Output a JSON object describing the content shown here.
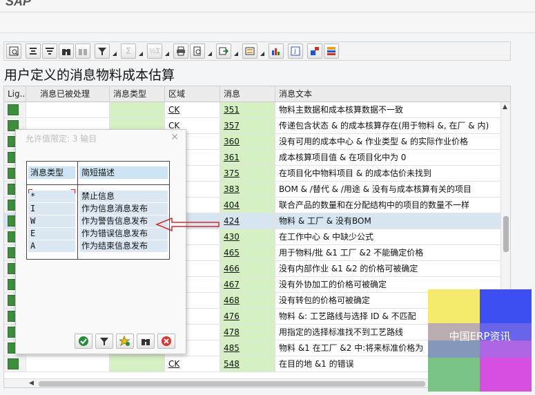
{
  "app": {
    "logo": "SAP"
  },
  "page_title": "用户定义的消息物料成本估算",
  "toolbar": {
    "buttons": [
      "details-icon",
      "align-left-icon",
      "filter-sort-icon",
      "binoculars-icon",
      "binoculars-next-icon",
      "filter-icon",
      "sum-icon",
      "subtotal-icon",
      "print-icon",
      "print-preview-icon",
      "export-icon",
      "layout-icon",
      "chart-icon",
      "info-icon",
      "graphic-icon",
      "grid-icon"
    ]
  },
  "grid": {
    "columns": [
      "Lig...",
      "消息已被处理",
      "消息类型",
      "区域",
      "消息",
      "消息文本"
    ],
    "rows": [
      {
        "area": "CK",
        "msg": "351",
        "text": "物料主数据和成本核算数据不一致"
      },
      {
        "area": "CK",
        "msg": "357",
        "text": "传递包含状态 & 的成本核算存在(用于物料 &, 在厂 & 内)"
      },
      {
        "area": "",
        "msg": "360",
        "text": "没有可用的成本中心 & 作业类型 & 的实际作业价格"
      },
      {
        "area": "",
        "msg": "361",
        "text": "成本核算项目值 & 在项目化中为 0"
      },
      {
        "area": "",
        "msg": "375",
        "text": "在项目化中物料项目 & 的成本估价未找到"
      },
      {
        "area": "",
        "msg": "383",
        "text": "BOM & /替代 & /用途 & 没有与成本核算有关的项目"
      },
      {
        "area": "",
        "msg": "404",
        "text": "联合产品的数量和在分配结构中的项目的数量不一样"
      },
      {
        "area": "",
        "msg": "424",
        "text": "物料 & 工厂 & 没有BOM",
        "selected": true
      },
      {
        "area": "",
        "msg": "430",
        "text": "在工作中心 & 中缺少公式"
      },
      {
        "area": "",
        "msg": "465",
        "text": "用于物料/批 &1 工厂 &2 不能确定价格"
      },
      {
        "area": "",
        "msg": "466",
        "text": "没有内部作业 &1 &2 的价格可被确定"
      },
      {
        "area": "",
        "msg": "467",
        "text": "没有外协加工的价格可被确定"
      },
      {
        "area": "",
        "msg": "468",
        "text": "没有转包的价格可被确定"
      },
      {
        "area": "",
        "msg": "476",
        "text": "物料 &: 工艺路线与选择 ID & 不匹配"
      },
      {
        "area": "",
        "msg": "478",
        "text": "用指定的选择标准找不到工艺路线"
      },
      {
        "area": "",
        "msg": "485",
        "text": "物料 &1 在工厂 &2 中:将来标准价格为"
      },
      {
        "area": "CK",
        "msg": "548",
        "text": "在目的地 &1 的错误"
      }
    ]
  },
  "popup": {
    "title": "允许值限定: 3 输目",
    "headers": [
      "消息类型",
      "简短描述"
    ],
    "items": [
      {
        "code": "*",
        "desc": "禁止信息"
      },
      {
        "code": "I",
        "desc": "作为信息消息发布"
      },
      {
        "code": "W",
        "desc": "作为警告信息发布"
      },
      {
        "code": "E",
        "desc": "作为错误信息发布"
      },
      {
        "code": "A",
        "desc": "作为结束信息发布"
      }
    ],
    "buttons": [
      "check-icon",
      "filter-icon",
      "new-entry-icon",
      "binoculars-icon",
      "cancel-icon"
    ]
  },
  "watermark": {
    "text": "中国ERP资讯",
    "colors": [
      "#f3ea6e",
      "#3d4ff0",
      "#7ac285",
      "#d64fe0"
    ]
  },
  "colors": {
    "green_cell": "#d5f1c4",
    "traffic_green": "#3e8e3e",
    "selected_row": "#d6e5ef",
    "arrow_red": "#d42a2a"
  }
}
